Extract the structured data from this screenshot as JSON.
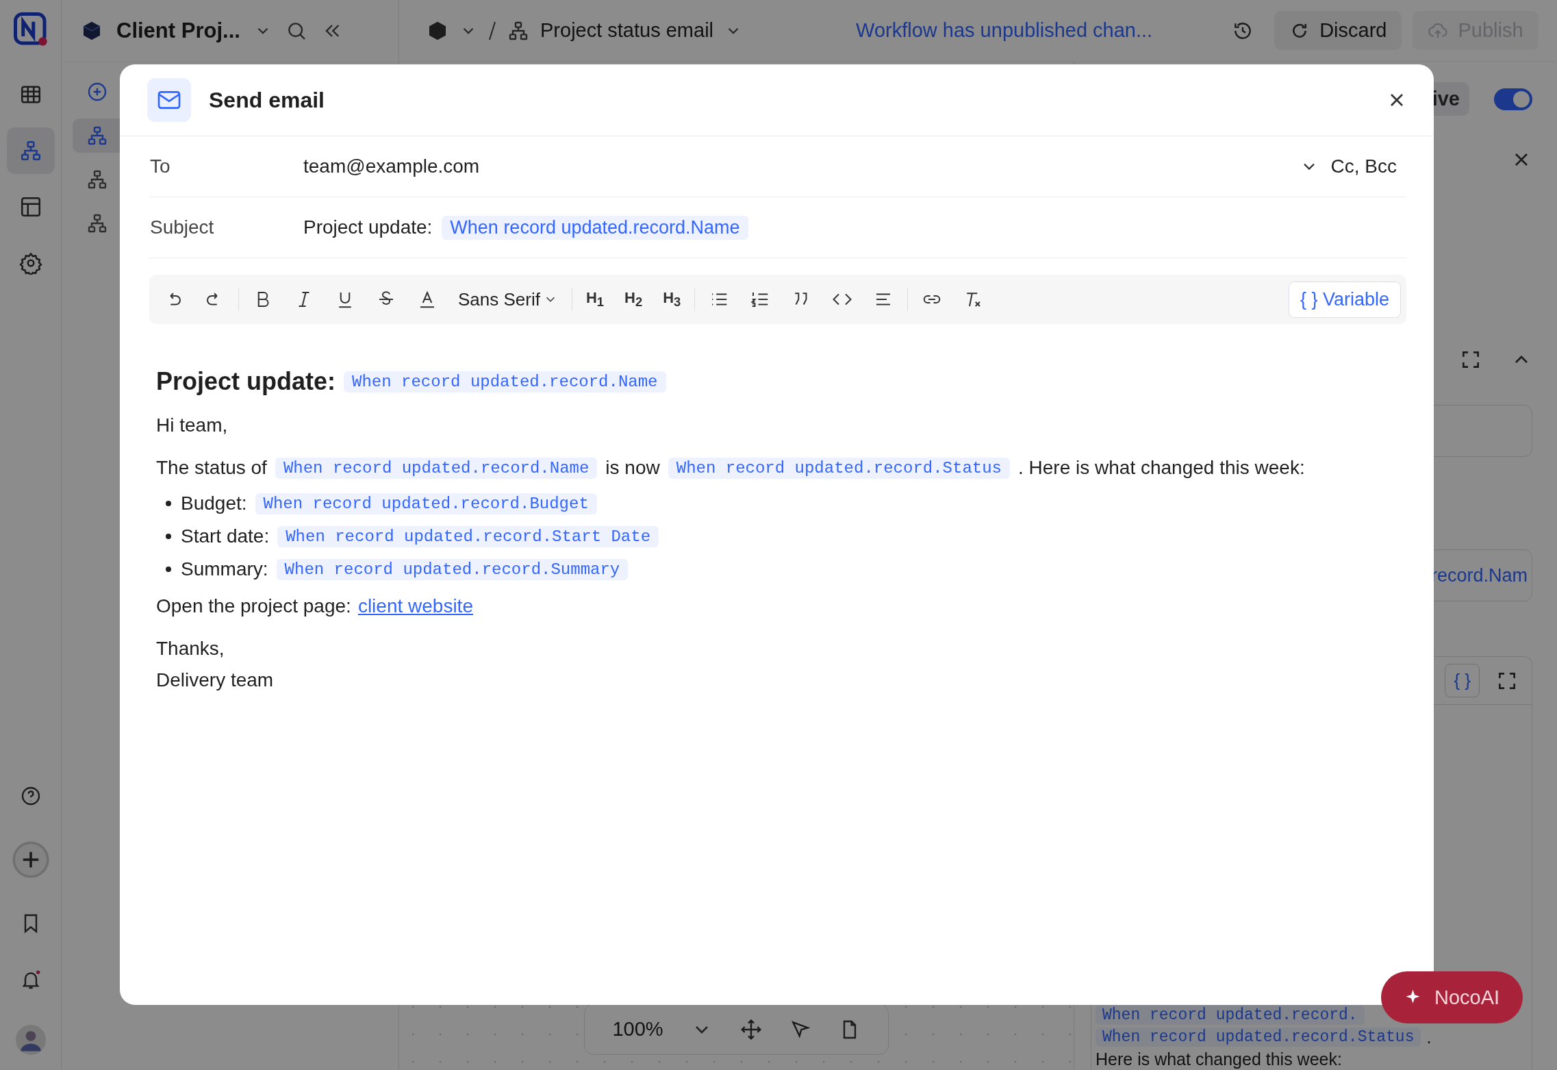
{
  "rail": [
    {
      "kind": "table",
      "selected": false
    },
    {
      "kind": "workflow",
      "selected": true
    },
    {
      "kind": "layout",
      "selected": false
    },
    {
      "kind": "settings",
      "selected": false
    }
  ],
  "sidebar": {
    "items": [
      {
        "kind": "add",
        "selected": false
      },
      {
        "kind": "workflow",
        "selected": true
      },
      {
        "kind": "workflow",
        "selected": false
      },
      {
        "kind": "workflow",
        "selected": false
      }
    ]
  },
  "app_bar": {
    "workspace": "Client Proj...",
    "workflow": "Project status email",
    "notice": "Workflow has unpublished chan...",
    "discard": "Discard",
    "publish": {
      "label": "Publish",
      "disabled": true
    }
  },
  "live": {
    "label": "ive",
    "on": true
  },
  "canvas": {
    "zoom": "100%"
  },
  "side_panel": {
    "field_value": "record.Nam",
    "variable_button": "{ }",
    "editor_lines": [
      {
        "variable": "When record updated.record."
      },
      {
        "variable": "When record updated.record.Status",
        "after": "."
      }
    ],
    "tail": "Here is what changed this week:"
  },
  "ai_button": "NocoAI",
  "modal": {
    "title": "Send email",
    "to_label": "To",
    "to": "team@example.com",
    "cc_bcc": "Cc, Bcc",
    "subject_label": "Subject",
    "subject": [
      {
        "kind": "text",
        "text": "Project update:"
      },
      {
        "kind": "variable",
        "text": "When record updated.record.Name"
      }
    ],
    "font": "Sans Serif",
    "headings": [
      "H$_{1}$",
      "H$_{2}$",
      "H$_{3}$"
    ],
    "variable_button": "{ } Variable",
    "body": [
      {
        "kind": "heading",
        "parts": [
          {
            "kind": "text",
            "text": "Project update:"
          },
          {
            "kind": "variable",
            "text": "When record updated.record.Name"
          }
        ]
      },
      {
        "kind": "paragraph",
        "parts": [
          {
            "kind": "text",
            "text": "Hi team,"
          }
        ]
      },
      {
        "kind": "paragraph",
        "parts": [
          {
            "kind": "text",
            "text": "The status of"
          },
          {
            "kind": "variable",
            "text": "When record updated.record.Name"
          },
          {
            "kind": "text",
            "text": "is now"
          },
          {
            "kind": "variable",
            "text": "When record updated.record.Status"
          },
          {
            "kind": "text",
            "text": ". Here is what changed this week:"
          }
        ]
      },
      {
        "kind": "bullet",
        "parts": [
          {
            "kind": "text",
            "text": "Budget:"
          },
          {
            "kind": "variable",
            "text": "When record updated.record.Budget"
          }
        ]
      },
      {
        "kind": "bullet",
        "parts": [
          {
            "kind": "text",
            "text": "Start date:"
          },
          {
            "kind": "variable",
            "text": "When record updated.record.Start Date"
          }
        ]
      },
      {
        "kind": "bullet",
        "parts": [
          {
            "kind": "text",
            "text": "Summary:"
          },
          {
            "kind": "variable",
            "text": "When record updated.record.Summary"
          }
        ]
      },
      {
        "kind": "paragraph",
        "parts": [
          {
            "kind": "text",
            "text": "Open the project page:"
          },
          {
            "kind": "link",
            "text": "client website"
          }
        ]
      },
      {
        "kind": "spaced",
        "parts": [
          {
            "kind": "text",
            "text": "Thanks,"
          }
        ]
      },
      {
        "kind": "tight",
        "parts": [
          {
            "kind": "text",
            "text": "Delivery team"
          }
        ]
      }
    ]
  }
}
